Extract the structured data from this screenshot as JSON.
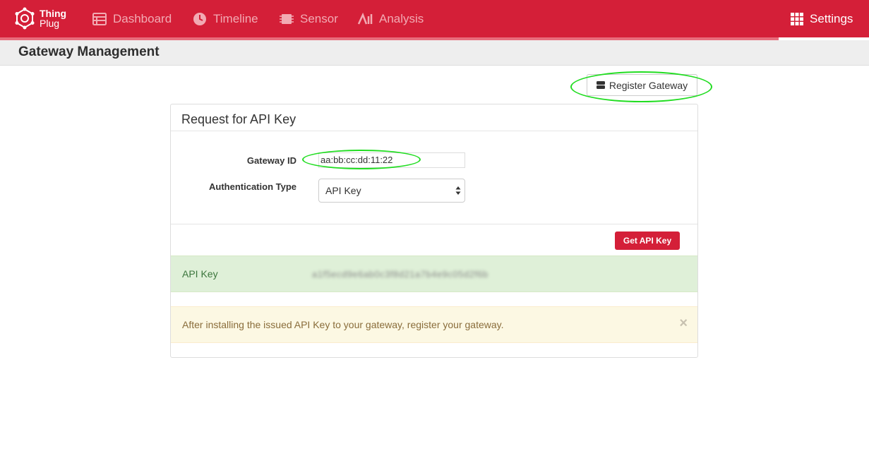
{
  "app": {
    "logo_line1": "Thing",
    "logo_line2": "Plug"
  },
  "nav": {
    "items": [
      {
        "label": "Dashboard",
        "icon": "dashboard-icon"
      },
      {
        "label": "Timeline",
        "icon": "clock-icon"
      },
      {
        "label": "Sensor",
        "icon": "chip-icon"
      },
      {
        "label": "Analysis",
        "icon": "analysis-icon"
      }
    ],
    "settings": {
      "label": "Settings",
      "icon": "grid-icon"
    }
  },
  "header": {
    "title": "Gateway Management"
  },
  "toolbar": {
    "register_label": "Register Gateway",
    "register_icon": "server-icon"
  },
  "panel": {
    "title": "Request for API Key",
    "gateway_id_label": "Gateway ID",
    "gateway_id_value": "aa:bb:cc:dd:11:22",
    "auth_type_label": "Authentication Type",
    "auth_type_value": "API Key",
    "get_key_label": "Get API Key",
    "api_key_label": "API Key",
    "api_key_value": "a1f5ecd9e6ab0c3f8d21a7b4e9c05d2f6b",
    "notice": "After installing the issued API Key to your gateway, register your gateway.",
    "notice_close": "×"
  },
  "colors": {
    "brand": "#d41f38",
    "success_bg": "#dff0d8",
    "warning_bg": "#fcf8e3",
    "highlight_ring": "#22dd22"
  }
}
